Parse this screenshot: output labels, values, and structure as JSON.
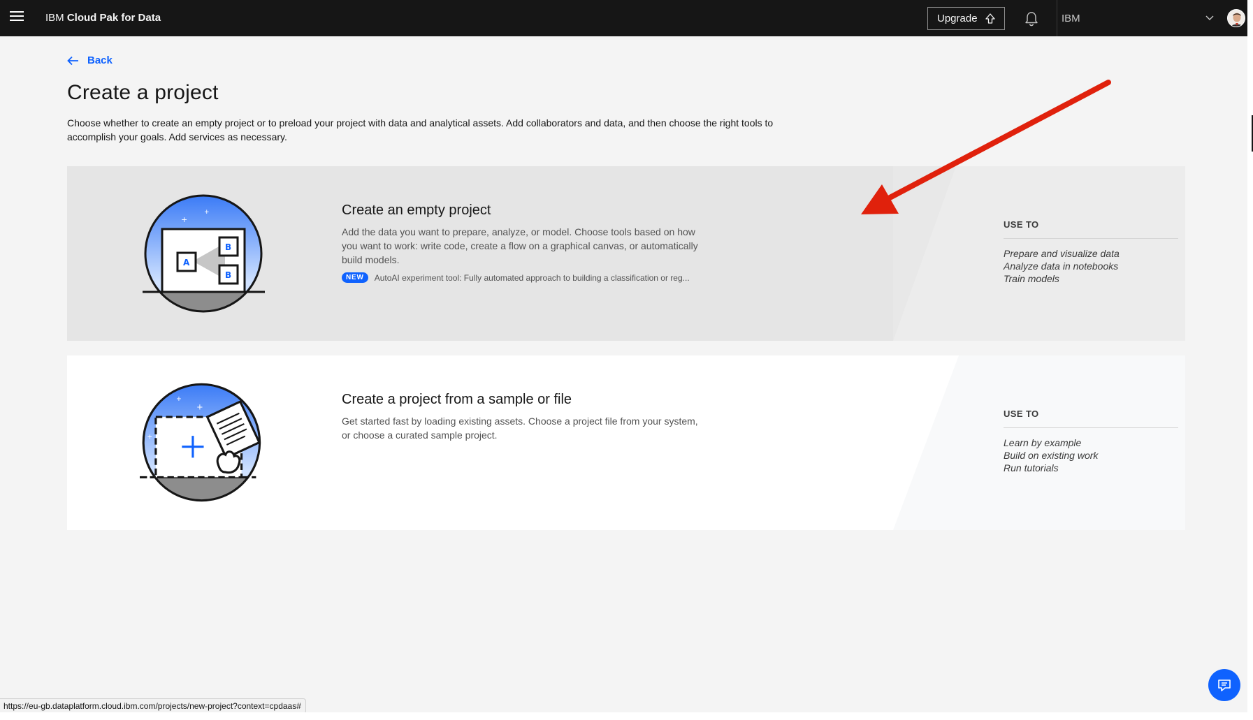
{
  "header": {
    "brand_prefix": "IBM",
    "brand_name": "Cloud Pak for Data",
    "upgrade_label": "Upgrade",
    "account_label": "IBM"
  },
  "back_label": "Back",
  "page_title": "Create a project",
  "description": "Choose whether to create an empty project or to preload your project with data and analytical assets. Add collaborators and data, and then choose the right tools to accomplish your goals. Add services as necessary.",
  "cards": [
    {
      "title": "Create an empty project",
      "description": "Add the data you want to prepare, analyze, or model. Choose tools based on how you want to work: write code, create a flow on a graphical canvas, or automatically build models.",
      "badge": "NEW",
      "badge_text": "AutoAI experiment tool: Fully automated approach to building a classification or reg...",
      "use_to_heading": "USE TO",
      "use_to": [
        "Prepare and visualize data",
        "Analyze data in notebooks",
        "Train models"
      ]
    },
    {
      "title": "Create a project from a sample or file",
      "description": "Get started fast by loading existing assets. Choose a project file from your system, or choose a curated sample project.",
      "use_to_heading": "USE TO",
      "use_to": [
        "Learn by example",
        "Build on existing work",
        "Run tutorials"
      ]
    }
  ],
  "status_url": "https://eu-gb.dataplatform.cloud.ibm.com/projects/new-project?context=cpdaas#",
  "illustration_labels": {
    "a": "A",
    "b": "B"
  },
  "colors": {
    "accent": "#0f62fe",
    "header_bg": "#161616",
    "annotation_arrow": "#e0210c"
  }
}
